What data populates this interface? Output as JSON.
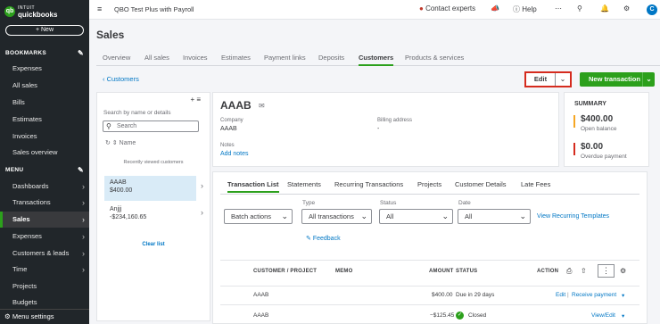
{
  "brand": {
    "line1": "INTUIT",
    "line2": "quickbooks",
    "logo_letter": "qb"
  },
  "sidebar": {
    "new_label": "+ New",
    "bookmarks_label": "BOOKMARKS",
    "bookmarks": [
      "Expenses",
      "All sales",
      "Bills",
      "Estimates",
      "Invoices",
      "Sales overview"
    ],
    "menu_label": "MENU",
    "menu": [
      "Dashboards",
      "Transactions",
      "Sales",
      "Expenses",
      "Customers & leads",
      "Time",
      "Projects",
      "Budgets"
    ],
    "active": "Sales",
    "bottom": "Menu settings"
  },
  "topbar": {
    "company": "QBO Test Plus with Payroll",
    "contact": "Contact experts",
    "help": "Help",
    "avatar": "C"
  },
  "page": {
    "title": "Sales"
  },
  "tabs": [
    "Overview",
    "All sales",
    "Invoices",
    "Estimates",
    "Payment links",
    "Deposits",
    "Customers",
    "Products & services"
  ],
  "active_tab": "Customers",
  "back_label": "Customers",
  "edit_label": "Edit",
  "new_transaction_label": "New transaction",
  "left_panel": {
    "search_label": "Search by name or details",
    "search_placeholder": "Search",
    "sort_label": "Name",
    "recent_label": "Recently viewed customers",
    "customers": [
      {
        "name": "AAAB",
        "amount": "$400.00"
      },
      {
        "name": "Anjjj",
        "amount": "-$234,160.65"
      }
    ],
    "clear_label": "Clear list"
  },
  "customer": {
    "name": "AAAB",
    "company_label": "Company",
    "company": "AAAB",
    "billing_label": "Billing address",
    "billing": "-",
    "notes_label": "Notes",
    "add_notes": "Add notes"
  },
  "summary": {
    "title": "SUMMARY",
    "open_amount": "$400.00",
    "open_label": "Open balance",
    "overdue_amount": "$0.00",
    "overdue_label": "Overdue payment",
    "open_color": "#f5a623",
    "overdue_color": "#d52b1e"
  },
  "detail_tabs": [
    "Transaction List",
    "Statements",
    "Recurring Transactions",
    "Projects",
    "Customer Details",
    "Late Fees"
  ],
  "filters": {
    "batch_label": "Batch actions",
    "type_label": "Type",
    "type_value": "All transactions",
    "status_label": "Status",
    "status_value": "All",
    "date_label": "Date",
    "date_value": "All",
    "recurring_link": "View Recurring Templates",
    "feedback_label": "Feedback"
  },
  "table": {
    "headers": [
      "CUSTOMER / PROJECT",
      "MEMO",
      "AMOUNT",
      "STATUS",
      "ACTION"
    ],
    "rows": [
      {
        "customer": "AAAB",
        "amount": "$400.00",
        "status": "Due in 29 days",
        "action1": "Edit",
        "action2": "Receive payment"
      },
      {
        "customer": "AAAB",
        "amount": "−$125.45",
        "status": "Closed",
        "action1": "View/Edit",
        "action2": ""
      }
    ]
  }
}
